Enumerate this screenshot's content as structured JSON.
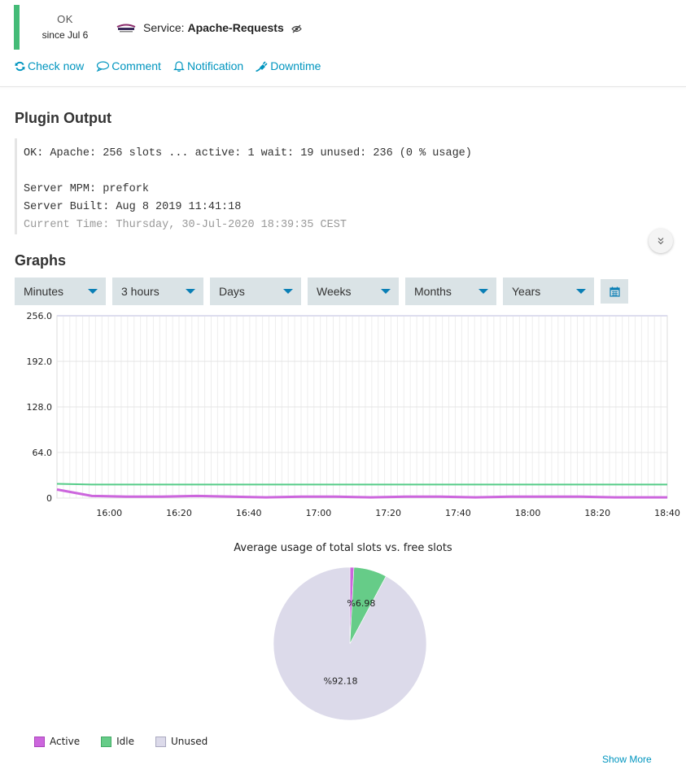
{
  "header": {
    "state": "OK",
    "since": "since Jul 6",
    "service_prefix": "Service:",
    "service_name": "Apache-Requests",
    "state_color": "#44bb77",
    "icons": [
      "apache-logo-icon",
      "eye-slash-icon"
    ]
  },
  "actions": [
    {
      "label": "Check now",
      "icon": "refresh-icon"
    },
    {
      "label": "Comment",
      "icon": "comment-icon"
    },
    {
      "label": "Notification",
      "icon": "bell-icon"
    },
    {
      "label": "Downtime",
      "icon": "plug-icon"
    }
  ],
  "plugin": {
    "title": "Plugin Output",
    "lines": [
      "OK: Apache: 256 slots ...  active: 1  wait: 19  unused: 236 (0 % usage)",
      "Server MPM: prefork",
      "Server Built: Aug  8 2019 11:41:18",
      "Current Time: Thursday, 30-Jul-2020 18:39:35 CEST"
    ]
  },
  "graphs": {
    "title": "Graphs",
    "ranges": [
      "Minutes",
      "3 hours",
      "Days",
      "Weeks",
      "Months",
      "Years"
    ],
    "accent": "#0a7fb5"
  },
  "chart_data": [
    {
      "type": "line",
      "yticks": [
        "0",
        "64.0",
        "128.0",
        "192.0",
        "256.0"
      ],
      "ylim": [
        0,
        256
      ],
      "xticks": [
        "16:00",
        "16:20",
        "16:40",
        "17:00",
        "17:20",
        "17:40",
        "18:00",
        "18:20",
        "18:40"
      ],
      "x": [
        "15:45",
        "15:55",
        "16:05",
        "16:15",
        "16:25",
        "16:35",
        "16:45",
        "16:55",
        "17:05",
        "17:15",
        "17:25",
        "17:35",
        "17:45",
        "17:55",
        "18:05",
        "18:15",
        "18:25",
        "18:35",
        "18:40"
      ],
      "series": [
        {
          "color": "#cc66dd",
          "values": [
            12,
            3,
            2,
            2,
            3,
            2,
            1,
            2,
            2,
            1,
            2,
            2,
            1,
            2,
            2,
            2,
            1,
            1,
            1
          ]
        },
        {
          "color": "#55cc88",
          "values": [
            20,
            19,
            19,
            19,
            19,
            19,
            19,
            19,
            19,
            19,
            19,
            19,
            19,
            19,
            19,
            19,
            19,
            19,
            19
          ]
        },
        {
          "color": "#ddddee",
          "values": [
            256,
            256,
            256,
            256,
            256,
            256,
            256,
            256,
            256,
            256,
            256,
            256,
            256,
            256,
            256,
            256,
            256,
            256,
            256
          ]
        }
      ]
    },
    {
      "type": "pie",
      "title": "Average usage of total slots vs. free slots",
      "slices": [
        {
          "name": "Active",
          "value": 0.84,
          "color": "#cc66dd",
          "label": ""
        },
        {
          "name": "Idle",
          "value": 6.98,
          "color": "#66cc88",
          "label": "%6.98"
        },
        {
          "name": "Unused",
          "value": 92.18,
          "color": "#dcdaea",
          "label": "%92.18"
        }
      ]
    }
  ],
  "footer_link": "Show More"
}
